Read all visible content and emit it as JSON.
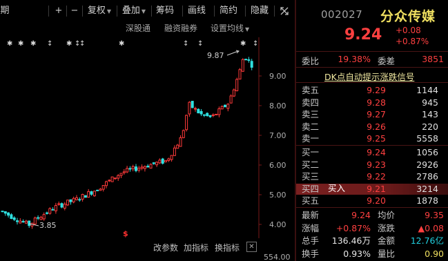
{
  "toolbar": {
    "period_label": "期",
    "plus_label": "+",
    "minus_label": "−",
    "adjust_label": "复权",
    "overlay_label": "叠加",
    "chips_label": "筹码",
    "draw_label": "画线",
    "brief_label": "简约",
    "hide_label": "隐藏",
    "collapse_icon": "collapse-icon"
  },
  "sub_toolbar": {
    "sz_label": "深股通",
    "margin_label": "融资融券",
    "ma_settings_label": "设置均线"
  },
  "chart": {
    "y_ticks": [
      "9.00",
      "8.00",
      "7.00",
      "6.00",
      "5.00",
      "4.00"
    ],
    "high_label": "9.87",
    "low_label": "3.85",
    "event_marker": "$",
    "volume_label": "554.00",
    "colors": {
      "up": "#ff3a3a",
      "down": "#2ee0e0",
      "axis": "#7a1a1a",
      "text": "#b0b0b0"
    }
  },
  "bottom_bar": {
    "params_label": "改参数",
    "add_indicator_label": "加指标",
    "switch_indicator_label": "换指标",
    "close_icon": "close-icon"
  },
  "quote": {
    "code": "002027",
    "name": "分众传媒",
    "price": "9.24",
    "change": "+0.08",
    "change_pct": "+0.87%",
    "weibi_label": "委比",
    "weibi_value": "19.38%",
    "weicha_label": "委差",
    "weicha_value": "3851",
    "dk_banner": "DK点自动提示涨跌信号",
    "buy_tip": "买入",
    "asks": [
      {
        "label": "卖五",
        "price": "9.29",
        "vol": "1144"
      },
      {
        "label": "卖四",
        "price": "9.28",
        "vol": "945"
      },
      {
        "label": "卖三",
        "price": "9.27",
        "vol": "143"
      },
      {
        "label": "卖二",
        "price": "9.26",
        "vol": "220"
      },
      {
        "label": "卖一",
        "price": "9.25",
        "vol": "5558"
      }
    ],
    "bids": [
      {
        "label": "买一",
        "price": "9.24",
        "vol": "1056"
      },
      {
        "label": "买二",
        "price": "9.23",
        "vol": "2926"
      },
      {
        "label": "买三",
        "price": "9.22",
        "vol": "2786"
      },
      {
        "label": "买四",
        "price": "9.21",
        "vol": "3214"
      },
      {
        "label": "买五",
        "price": "9.20",
        "vol": "1878"
      }
    ],
    "stats": [
      {
        "l1": "最新",
        "v1": "9.24",
        "c1": "red",
        "l2": "均价",
        "v2": "9.35",
        "c2": "red"
      },
      {
        "l1": "涨幅",
        "v1": "+0.87%",
        "c1": "red",
        "l2": "涨跌",
        "v2": "▲0.08",
        "c2": "red"
      },
      {
        "l1": "总手",
        "v1": "136.46万",
        "c1": "white",
        "l2": "金额",
        "v2": "12.76亿",
        "c2": "cyan"
      },
      {
        "l1": "换手",
        "v1": "0.93%",
        "c1": "white",
        "l2": "量比",
        "v2": "0.90",
        "c2": "yellow"
      }
    ]
  }
}
